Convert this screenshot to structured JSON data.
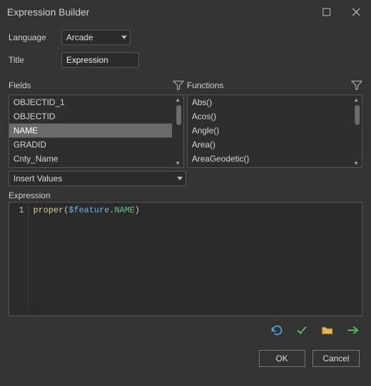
{
  "window": {
    "title": "Expression Builder"
  },
  "lang_row": {
    "label": "Language",
    "value": "Arcade"
  },
  "title_row": {
    "label": "Title",
    "value": "Expression"
  },
  "fields": {
    "header": "Fields",
    "items": [
      {
        "label": "OBJECTID_1",
        "selected": false
      },
      {
        "label": "OBJECTID",
        "selected": false
      },
      {
        "label": "NAME",
        "selected": true
      },
      {
        "label": "GRADID",
        "selected": false
      },
      {
        "label": "Cnty_Name",
        "selected": false
      }
    ]
  },
  "functions": {
    "header": "Functions",
    "items": [
      {
        "label": "Abs()"
      },
      {
        "label": "Acos()"
      },
      {
        "label": "Angle()"
      },
      {
        "label": "Area()"
      },
      {
        "label": "AreaGeodetic()"
      }
    ]
  },
  "insert_values": {
    "label": "Insert Values"
  },
  "expression": {
    "label": "Expression",
    "line_number": "1",
    "tokens": {
      "fn": "proper",
      "open": "(",
      "var": "$feature",
      "dot": ".",
      "prop": "NAME",
      "close": ")"
    }
  },
  "buttons": {
    "ok": "OK",
    "cancel": "Cancel"
  },
  "icons": {
    "undo": "undo-icon",
    "validate": "validate-icon",
    "folder": "folder-icon",
    "go": "go-icon"
  }
}
